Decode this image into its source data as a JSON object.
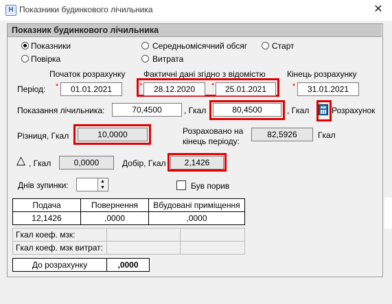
{
  "window": {
    "title": "Показники будинкового лічильника",
    "close_glyph": "✕",
    "app_icon_letter": "H"
  },
  "group": {
    "title": "Показник будинкового лічильника"
  },
  "radios": [
    {
      "label": "Показники",
      "selected": true
    },
    {
      "label": "Повірка",
      "selected": false
    },
    {
      "label": "Середньомісячний обсяг",
      "selected": false
    },
    {
      "label": "Витрата",
      "selected": false
    },
    {
      "label": "Старт",
      "selected": false
    }
  ],
  "period": {
    "label": "Період:",
    "required_mark": "*",
    "start_header": "Початок розрахунку",
    "actual_header": "Фактичні дані згідно з відомістю",
    "end_header": "Кінець розрахунку",
    "start_value": "01.01.2021",
    "actual_from": "28.12.2020",
    "actual_to": "25.01.2021",
    "end_value": "31.01.2021"
  },
  "readings": {
    "label": "Показання лічильника:",
    "value1": "70,4500",
    "unit1": ", Гкал",
    "value2": "80,4500",
    "unit2": ", Гкал",
    "calc_label": "Розрахунок"
  },
  "difference": {
    "label": "Різниця, Гкал",
    "value": "10,0000"
  },
  "calculated_end": {
    "label_line1": "Розраховано на",
    "label_line2": "кінець періоду:",
    "value": "82,5926",
    "unit": "Гкал"
  },
  "delta": {
    "symbol": "△",
    "label": ", Гкал",
    "value": "0,0000"
  },
  "dobir": {
    "label": "Добір, Гкал",
    "value": "2,1426"
  },
  "stop_days": {
    "label": "Днів зупинки:",
    "value": ""
  },
  "burst": {
    "label": "Був порив",
    "checked": false
  },
  "table1": {
    "headers": [
      "Подача",
      "Повернення",
      "Вбудовані приміщення"
    ],
    "row": [
      "12,1426",
      ",0000",
      ",0000"
    ]
  },
  "table2": {
    "rows": [
      {
        "label": "Гкал коеф. мзк:",
        "values": [
          "",
          ""
        ]
      },
      {
        "label": "Гкал коеф. мзк витрат:",
        "values": [
          "",
          ""
        ]
      }
    ]
  },
  "total": {
    "label": "До розрахунку",
    "value": ",0000"
  },
  "colors": {
    "highlight": "#e00000",
    "titlebar": "#ffffff",
    "background": "#f0f0f0"
  }
}
